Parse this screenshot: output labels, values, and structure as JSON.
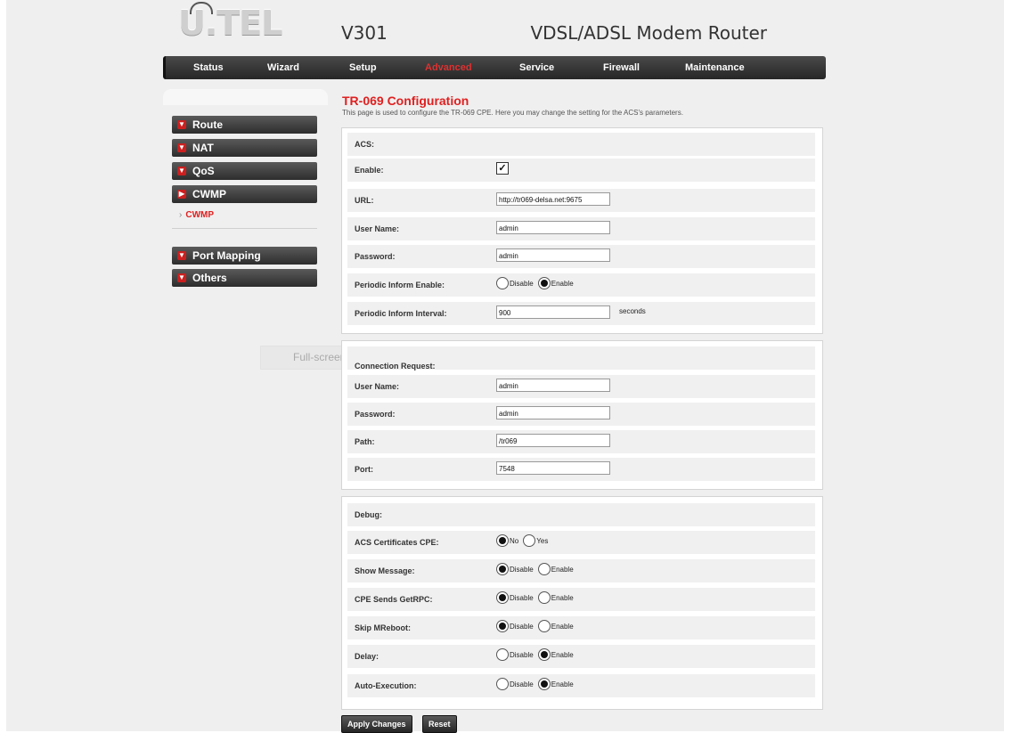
{
  "header": {
    "logo_text": "U.TEL",
    "model": "V301",
    "product": "VDSL/ADSL Modem Router"
  },
  "nav": {
    "items": [
      "Status",
      "Wizard",
      "Setup",
      "Advanced",
      "Service",
      "Firewall",
      "Maintenance"
    ],
    "active": "Advanced"
  },
  "sidebar": {
    "items": [
      "Route",
      "NAT",
      "QoS",
      "CWMP",
      "Port Mapping",
      "Others"
    ],
    "sub_item": "CWMP",
    "ghost_text": "Full-screen"
  },
  "page": {
    "title": "TR-069 Configuration",
    "description": "This page is used to configure the TR-069 CPE. Here you may change the setting for the ACS's parameters."
  },
  "acs": {
    "heading": "ACS:",
    "enable_label": "Enable:",
    "enable_checked": true,
    "url_label": "URL:",
    "url": "http://tr069-delsa.net:9675",
    "username_label": "User Name:",
    "username": "admin",
    "password_label": "Password:",
    "password": "admin",
    "periodic_enable_label": "Periodic Inform Enable:",
    "periodic_interval_label": "Periodic Inform Interval:",
    "periodic_interval": "900",
    "seconds": "seconds"
  },
  "radio_labels": {
    "disable": "Disable",
    "enable": "Enable",
    "no": "No",
    "yes": "Yes"
  },
  "connection": {
    "heading": "Connection Request:",
    "username_label": "User Name:",
    "username": "admin",
    "password_label": "Password:",
    "password": "admin",
    "path_label": "Path:",
    "path": "/tr069",
    "port_label": "Port:",
    "port": "7548"
  },
  "debug": {
    "heading": "Debug:",
    "acs_cert_label": "ACS Certificates CPE:",
    "show_message_label": "Show Message:",
    "cpe_sends_label": "CPE Sends GetRPC:",
    "skip_label": "Skip MReboot:",
    "delay_label": "Delay:",
    "auto_exec_label": "Auto-Execution:"
  },
  "buttons": {
    "apply": "Apply Changes",
    "reset": "Reset"
  }
}
